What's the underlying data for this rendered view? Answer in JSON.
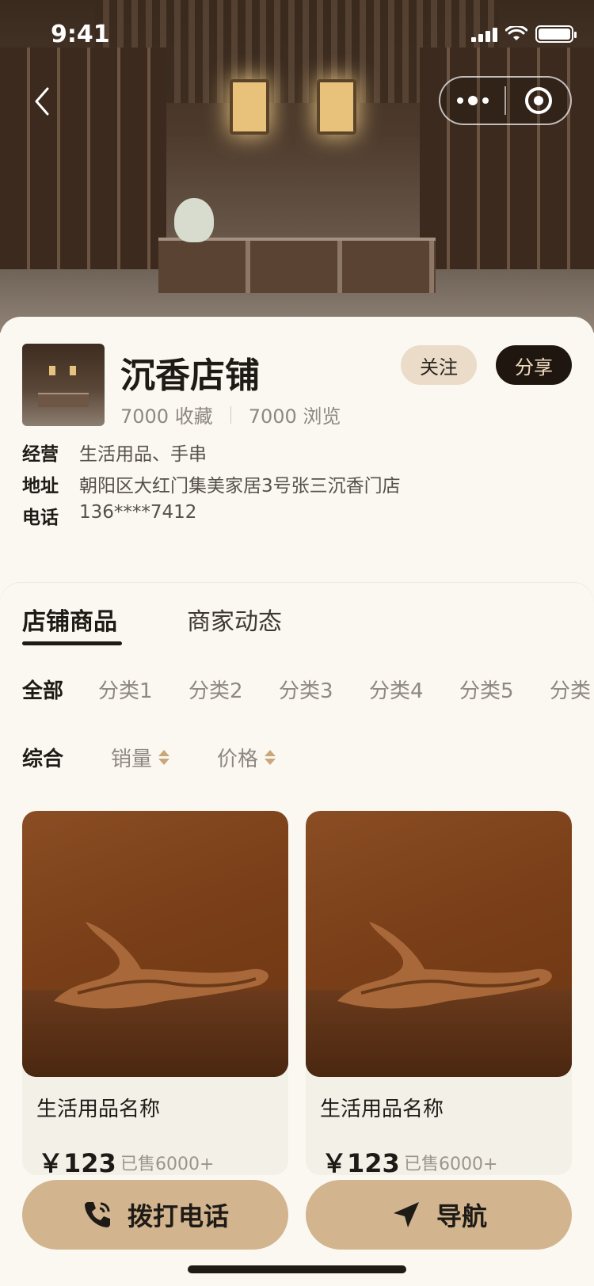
{
  "status_bar": {
    "time": "9:41"
  },
  "shop": {
    "name": "沉香店铺",
    "favorites": "7000 收藏",
    "views": "7000 浏览",
    "follow_label": "关注",
    "share_label": "分享",
    "info": [
      {
        "key": "经营",
        "value": "生活用品、手串"
      },
      {
        "key": "地址",
        "value": "朝阳区大红门集美家居3号张三沉香门店"
      },
      {
        "key": "电话",
        "value": "136****7412"
      }
    ]
  },
  "tabs": [
    {
      "label": "店铺商品",
      "active": true
    },
    {
      "label": "商家动态",
      "active": false
    }
  ],
  "categories": [
    "全部",
    "分类1",
    "分类2",
    "分类3",
    "分类4",
    "分类5",
    "分类"
  ],
  "sorts": [
    "综合",
    "销量",
    "价格"
  ],
  "products": [
    {
      "title": "生活用品名称",
      "price": "￥123",
      "sold": "已售6000+"
    },
    {
      "title": "生活用品名称",
      "price": "￥123",
      "sold": "已售6000+"
    }
  ],
  "actions": {
    "call_label": "拨打电话",
    "nav_label": "导航"
  },
  "colors": {
    "accent": "#d2b48e",
    "dark": "#1f160f",
    "background": "#fbf8f2"
  }
}
